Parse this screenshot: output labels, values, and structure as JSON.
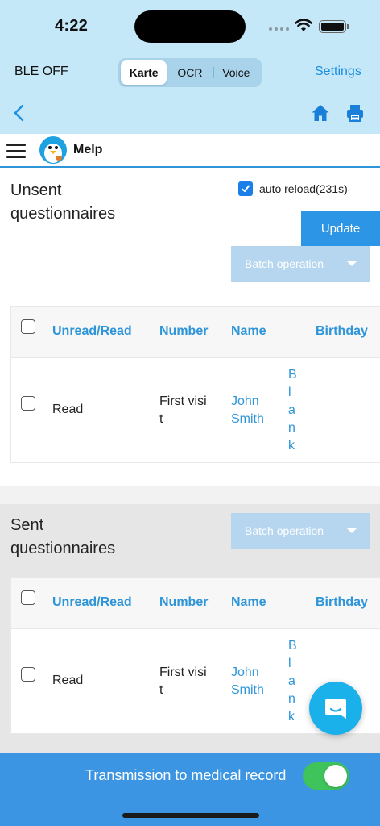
{
  "status_bar": {
    "time": "4:22"
  },
  "nav": {
    "ble_status": "BLE OFF",
    "segments": [
      "Karte",
      "OCR",
      "Voice"
    ],
    "active_segment": "Karte",
    "settings_label": "Settings"
  },
  "app": {
    "brand": "Melp"
  },
  "unsent": {
    "title_line1": "Unsent",
    "title_line2": "questionnaires",
    "auto_reload_label": "auto reload(231s)",
    "auto_reload_checked": true,
    "update_label": "Update",
    "batch_label": "Batch operation",
    "columns": [
      "Unread/Read",
      "Number",
      "Name",
      "Birthday"
    ],
    "rows": [
      {
        "status": "Read",
        "number_line1": "First visi",
        "number_line2": "t",
        "name_line1": "John",
        "name_line2": "Smith",
        "birthday": "Blank"
      }
    ]
  },
  "sent": {
    "title_line1": "Sent",
    "title_line2": "questionnaires",
    "batch_label": "Batch operation",
    "columns": [
      "Unread/Read",
      "Number",
      "Name",
      "Birthday"
    ],
    "rows": [
      {
        "status": "Read",
        "number_line1": "First visi",
        "number_line2": "t",
        "name_line1": "John",
        "name_line2": "Smith",
        "birthday": "Blank"
      }
    ]
  },
  "footer": {
    "transmission_label": "Transmission to medical record",
    "transmission_on": true
  },
  "colors": {
    "accent": "#2d95d8",
    "header_bg": "#c5e8f8",
    "bottom_bar": "#3b95e3",
    "toggle_on": "#3ec45a",
    "fab": "#1ab0ea"
  }
}
